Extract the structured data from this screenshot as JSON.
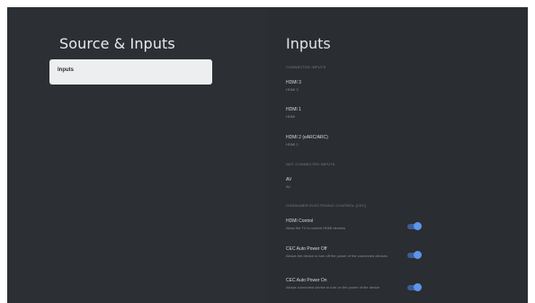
{
  "left": {
    "title": "Source & Inputs",
    "menu_items": [
      {
        "label": "Inputs"
      }
    ]
  },
  "right": {
    "title": "Inputs",
    "sections": {
      "connected_inputs": "CONNECTED INPUTS",
      "not_connected": "NOT CONNECTED INPUTS",
      "consumer_electronic_control": "CONSUMER ELECTRONIC CONTROL (CEC)"
    },
    "inputs": [
      {
        "name": "HDMI 3",
        "sub": "HDMI 3"
      },
      {
        "name": "HDMI 1",
        "sub": "HDMI"
      },
      {
        "name": "HDMI 2 (eARC/ARC)",
        "sub": "HDMI 2"
      }
    ],
    "not_connected_inputs": [
      {
        "name": "AV",
        "sub": "AV"
      }
    ],
    "cec": [
      {
        "name": "HDMI Control",
        "sub": "Allow the TV to control HDMI devices",
        "enabled": true
      },
      {
        "name": "CEC Auto Power Off",
        "sub": "Allows the device to turn off the power of the connected devices",
        "enabled": true
      },
      {
        "name": "CEC Auto Power On",
        "sub": "Allows connected device to turn on the power of the device",
        "enabled": true
      }
    ]
  },
  "colors": {
    "background": "#2a2d31",
    "selected_item": "#eceef0",
    "toggle_on": "#5d95e8"
  }
}
